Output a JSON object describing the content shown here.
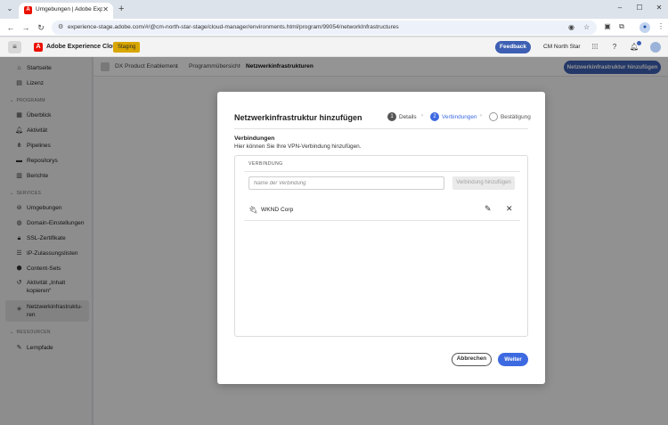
{
  "browser": {
    "tab_title": "Umgebungen | Adobe Experience",
    "url": "experience-stage.adobe.com/#/@cm-north-star-stage/cloud-manager/environments.html/program/99054/networkInfrastructures",
    "profile_initial": "●"
  },
  "header": {
    "app_title": "Adobe Experience Cloud",
    "env_badge": "Staging",
    "feedback_label": "Feedback",
    "org_name": "CM North Star"
  },
  "sidebar": {
    "top_items": [
      {
        "label": "Startseite",
        "icon": "home-icon"
      },
      {
        "label": "Lizenz",
        "icon": "license-icon"
      }
    ],
    "section_program": "PROGRAMM",
    "program_items": [
      {
        "label": "Überblick",
        "icon": "overview-icon"
      },
      {
        "label": "Aktivität",
        "icon": "activity-icon"
      },
      {
        "label": "Pipelines",
        "icon": "pipelines-icon"
      },
      {
        "label": "Repositorys",
        "icon": "folder-icon"
      },
      {
        "label": "Berichte",
        "icon": "reports-icon"
      }
    ],
    "section_services": "SERVICES",
    "service_items": [
      {
        "label": "Umgebungen",
        "icon": "environments-icon"
      },
      {
        "label": "Domain-Einstellungen",
        "icon": "domain-icon"
      },
      {
        "label": "SSL-Zertifikate",
        "icon": "lock-icon"
      },
      {
        "label": "IP-Zulassungslisten",
        "icon": "list-icon"
      },
      {
        "label": "Content-Sets",
        "icon": "content-sets-icon"
      },
      {
        "label": "Aktivität „Inhalt kopieren“",
        "icon": "history-icon"
      },
      {
        "label": "Netzwerkinfrastruktu-ren",
        "icon": "network-icon"
      }
    ],
    "section_resources": "RESSOURCEN",
    "resource_items": [
      {
        "label": "Lernpfade",
        "icon": "learn-icon"
      }
    ]
  },
  "breadcrumb": {
    "program": "DX Product Enablement",
    "overview": "Programmübersicht",
    "current": "Netzwerkinfrastrukturen"
  },
  "main": {
    "add_button_label": "Netzwerkinfrastruktur hinzufügen"
  },
  "modal": {
    "title": "Netzwerkinfrastruktur hinzufügen",
    "steps": [
      {
        "num": "1",
        "label": "Details",
        "state": "complete"
      },
      {
        "num": "2",
        "label": "Verbindungen",
        "state": "active"
      },
      {
        "num": "",
        "label": "Bestätigung",
        "state": "pending"
      }
    ],
    "section_title": "Verbindungen",
    "section_desc": "Hier können Sie Ihre VPN-Verbindung hinzufügen.",
    "panel_header": "VERBINDUNG",
    "input_placeholder": "Name der Verbindung",
    "add_connection_label": "Verbindung hinzufügen",
    "connections": [
      {
        "name": "WKND Corp"
      }
    ],
    "cancel_label": "Abbrechen",
    "next_label": "Weiter"
  },
  "colors": {
    "accent": "#3d5fb3",
    "cta": "#3d6ae0",
    "badge": "#d9a600",
    "adobe_red": "#eb1000"
  }
}
